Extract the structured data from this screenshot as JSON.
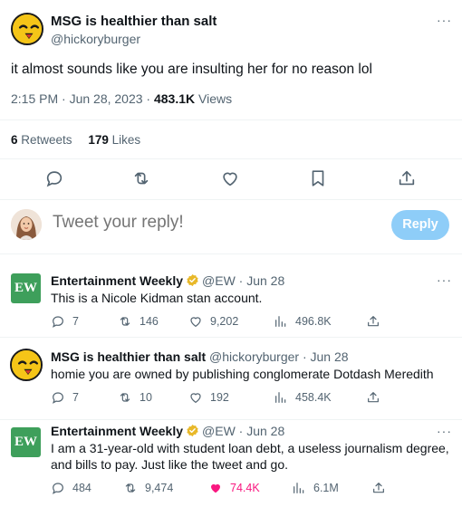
{
  "main_tweet": {
    "author_name": "MSG is healthier than salt",
    "author_handle": "@hickoryburger",
    "text": "it almost sounds like you are insulting her for no reason lol",
    "time": "2:15 PM · Jun 28, 2023 · ",
    "views_count": "483.1K",
    "views_label": " Views",
    "retweets_count": "6",
    "retweets_label": " Retweets",
    "likes_count": "179",
    "likes_label": " Likes",
    "more_label": "···"
  },
  "reply_box": {
    "placeholder": "Tweet your reply!",
    "button_label": "Reply"
  },
  "replies": [
    {
      "author_name": "Entertainment Weekly",
      "meta": "@EW · Jun 28",
      "text": "This is a Nicole Kidman stan account.",
      "logo_text": "EW",
      "replies": "7",
      "retweets": "146",
      "likes": "9,202",
      "views": "496.8K"
    },
    {
      "author_name": "MSG is healthier than salt",
      "meta": "@hickoryburger · Jun 28",
      "text": "homie you are owned by publishing conglomerate Dotdash Meredith",
      "replies": "7",
      "retweets": "10",
      "likes": "192",
      "views": "458.4K"
    },
    {
      "author_name": "Entertainment Weekly",
      "meta": "@EW · Jun 28",
      "text": "I am a 31-year-old with student loan debt, a useless journalism degree, and bills to pay. Just like the tweet and go.",
      "logo_text": "EW",
      "replies": "484",
      "retweets": "9,474",
      "likes": "74.4K",
      "views": "6.1M"
    }
  ],
  "colors": {
    "ew_green": "#3e9f5b",
    "like_pink": "#f91880",
    "reply_button": "#8ecdf8",
    "verified_gold": "#e8b829"
  }
}
